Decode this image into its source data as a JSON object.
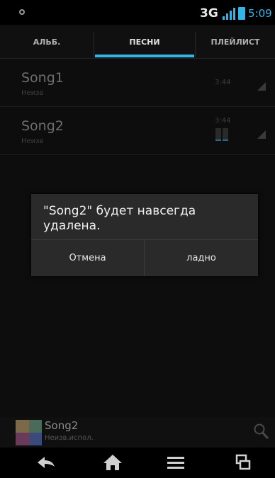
{
  "status_bar": {
    "network": "3G",
    "time": "5:09"
  },
  "tabs": [
    {
      "label": "АЛЬБ."
    },
    {
      "label": "ПЕСНИ"
    },
    {
      "label": "ПЛЕЙЛИСТ"
    }
  ],
  "songs": [
    {
      "title": "Song1",
      "artist": "Неизв",
      "duration": "3:44"
    },
    {
      "title": "Song2",
      "artist": "Неизв",
      "duration": "3:44"
    }
  ],
  "dialog": {
    "message": "\"Song2\" будет навсегда удалена.",
    "cancel_label": "Отмена",
    "ok_label": "ладно"
  },
  "now_playing": {
    "title": "Song2",
    "artist": "Неизв.испол."
  },
  "colors": {
    "accent": "#33b5e5"
  },
  "icons": [
    "notification-icon",
    "signal-icon",
    "battery-icon",
    "menu-triangle-icon",
    "equalizer-icon",
    "search-icon",
    "back-icon",
    "home-icon",
    "menu-icon",
    "recent-apps-icon"
  ]
}
